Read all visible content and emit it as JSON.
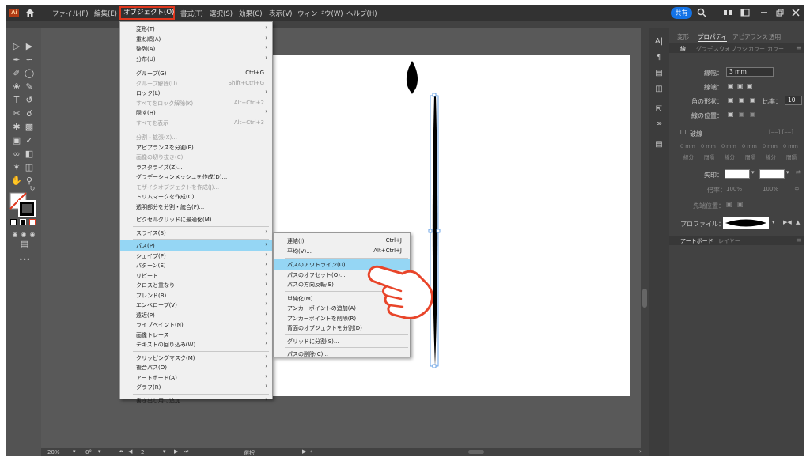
{
  "app": {
    "logo_text": "Ai"
  },
  "menubar": {
    "items": [
      "ファイル(F)",
      "編集(E)",
      "オブジェクト(O)",
      "書式(T)",
      "選択(S)",
      "効果(C)",
      "表示(V)",
      "ウィンドウ(W)",
      "ヘルプ(H)"
    ],
    "share_label": "共有"
  },
  "object_menu": [
    {
      "label": "変形(T)",
      "arrow": true
    },
    {
      "label": "重ね順(A)",
      "arrow": true
    },
    {
      "label": "整列(A)",
      "arrow": true
    },
    {
      "label": "分布(U)",
      "arrow": true
    },
    {
      "label": "グループ(G)",
      "shortcut": "Ctrl+G"
    },
    {
      "label": "グループ解除(U)",
      "shortcut": "Shift+Ctrl+G",
      "disabled": true
    },
    {
      "label": "ロック(L)",
      "arrow": true
    },
    {
      "label": "すべてをロック解除(K)",
      "shortcut": "Alt+Ctrl+2",
      "disabled": true
    },
    {
      "label": "隠す(H)",
      "arrow": true
    },
    {
      "label": "すべてを表示",
      "shortcut": "Alt+Ctrl+3",
      "disabled": true
    },
    {
      "label": "分割・拡張(X)...",
      "disabled": true
    },
    {
      "label": "アピアランスを分割(E)"
    },
    {
      "label": "画像の切り抜き(C)",
      "disabled": true
    },
    {
      "label": "ラスタライズ(Z)..."
    },
    {
      "label": "グラデーションメッシュを作成(D)..."
    },
    {
      "label": "モザイクオブジェクトを作成(J)...",
      "disabled": true
    },
    {
      "label": "トリムマークを作成(C)"
    },
    {
      "label": "透明部分を分割・統合(F)..."
    },
    {
      "label": "ピクセルグリッドに最適化(M)"
    },
    {
      "label": "スライス(S)",
      "arrow": true
    },
    {
      "label": "パス(P)",
      "arrow": true,
      "highlighted": true
    },
    {
      "label": "シェイプ(P)",
      "arrow": true
    },
    {
      "label": "パターン(E)",
      "arrow": true
    },
    {
      "label": "リピート",
      "arrow": true
    },
    {
      "label": "クロスと重なり",
      "arrow": true
    },
    {
      "label": "ブレンド(B)",
      "arrow": true
    },
    {
      "label": "エンベロープ(V)",
      "arrow": true
    },
    {
      "label": "遠近(P)",
      "arrow": true
    },
    {
      "label": "ライブペイント(N)",
      "arrow": true
    },
    {
      "label": "画像トレース",
      "arrow": true
    },
    {
      "label": "テキストの回り込み(W)",
      "arrow": true
    },
    {
      "label": "クリッピングマスク(M)",
      "arrow": true
    },
    {
      "label": "複合パス(O)",
      "arrow": true
    },
    {
      "label": "アートボード(A)",
      "arrow": true
    },
    {
      "label": "グラフ(R)",
      "arrow": true
    },
    {
      "label": "書き出し用に追加",
      "arrow": true
    }
  ],
  "path_submenu": [
    {
      "label": "連結(J)",
      "shortcut": "Ctrl+J"
    },
    {
      "label": "平均(V)...",
      "shortcut": "Alt+Ctrl+J"
    },
    {
      "label": "パスのアウトライン(U)",
      "highlighted": true
    },
    {
      "label": "パスのオフセット(O)..."
    },
    {
      "label": "パスの方向反転(E)"
    },
    {
      "label": "単純化(M)..."
    },
    {
      "label": "アンカーポイントの追加(A)"
    },
    {
      "label": "アンカーポイントを削除(R)"
    },
    {
      "label": "背面のオブジェクトを分割(D)"
    },
    {
      "label": "グリッドに分割(S)..."
    },
    {
      "label": "パスの削除(C)..."
    }
  ],
  "properties": {
    "tabs": [
      "変形",
      "プロパティ",
      "アピアランス",
      "透明"
    ],
    "sub_tabs": [
      "線",
      "グラデ",
      "スウォ",
      "ブラシ",
      "カラー",
      "カラー"
    ],
    "stroke_width_label": "線幅：",
    "stroke_width_value": "3 mm",
    "cap_label": "線端：",
    "corner_label": "角の形状：",
    "limit_label": "比率：",
    "limit_value": "10",
    "align_label": "線の位置：",
    "dash_label": "破線",
    "dash_fields": [
      "0 mm",
      "0 mm",
      "0 mm",
      "0 mm",
      "0 mm",
      "0 mm"
    ],
    "dash_headers": [
      "線分",
      "間隔",
      "線分",
      "間隔",
      "線分",
      "間隔"
    ],
    "arrow_label": "矢印：",
    "scale_label": "倍率：",
    "scale_values": [
      "100%",
      "100%"
    ],
    "tip_label": "先端位置：",
    "profile_label": "プロファイル：",
    "bottom_tabs": [
      "アートボード",
      "レイヤー"
    ]
  },
  "status": {
    "zoom": "20%",
    "rotate": "0°",
    "page": "2",
    "tool": "選択"
  },
  "colors": {
    "highlight": "#95d6f4",
    "accent": "#e0361c",
    "hand": "#e8452a"
  }
}
